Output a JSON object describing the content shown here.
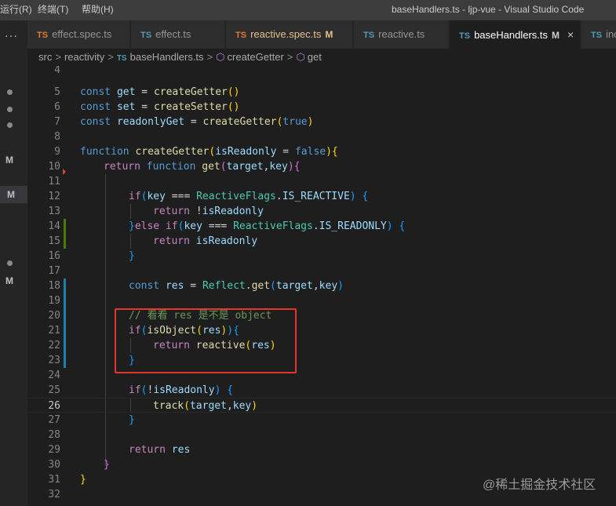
{
  "titlebar": {
    "menu_run": "运行(R)",
    "menu_terminal": "终端(T)",
    "menu_help": "帮助(H)",
    "window_title": "baseHandlers.ts - ljp-vue - Visual Studio Code"
  },
  "activity": {
    "more": "···",
    "badge_m": "M"
  },
  "tabs": [
    {
      "badge": "TS",
      "label": "effect.spec.ts",
      "mod": "",
      "active": false
    },
    {
      "badge": "TS",
      "label": "effect.ts",
      "mod": "",
      "active": false
    },
    {
      "badge": "TS",
      "label": "reactive.spec.ts",
      "mod": "M",
      "active": false
    },
    {
      "badge": "TS",
      "label": "reactive.ts",
      "mod": "",
      "active": false
    },
    {
      "badge": "TS",
      "label": "baseHandlers.ts",
      "mod": "M",
      "active": true,
      "close": "×"
    },
    {
      "badge": "TS",
      "label": "inc",
      "mod": "",
      "active": false
    }
  ],
  "breadcrumb": {
    "src": "src",
    "reactivity": "reactivity",
    "ts_badge": "TS",
    "file": "baseHandlers.ts",
    "symbol1": "createGetter",
    "symbol2": "get",
    "sep": ">"
  },
  "editor": {
    "line_numbers": [
      "4",
      "5",
      "6",
      "7",
      "8",
      "9",
      "10",
      "11",
      "12",
      "13",
      "14",
      "15",
      "16",
      "17",
      "18",
      "19",
      "20",
      "21",
      "22",
      "23",
      "24",
      "25",
      "26",
      "27",
      "28",
      "29",
      "30",
      "31",
      "32"
    ],
    "code": {
      "l5a": "const ",
      "l5b": "get",
      "l5c": " = ",
      "l5d": "createGetter",
      "l5e": "()",
      "l6a": "const ",
      "l6b": "set",
      "l6c": " = ",
      "l6d": "createSetter",
      "l6e": "()",
      "l7a": "const ",
      "l7b": "readonlyGet",
      "l7c": " = ",
      "l7d": "createGetter",
      "l7e": "(",
      "l7f": "true",
      "l7g": ")",
      "l9a": "function ",
      "l9b": "createGetter",
      "l9c": "(",
      "l9d": "isReadonly",
      "l9e": " = ",
      "l9f": "false",
      "l9g": "){",
      "l10a": "return ",
      "l10b": "function ",
      "l10c": "get",
      "l10d": "(",
      "l10e": "target",
      "l10f": ",",
      "l10g": "key",
      "l10h": "){",
      "l12a": "if",
      "l12b": "(",
      "l12c": "key",
      "l12d": " === ",
      "l12e": "ReactiveFlags",
      "l12f": ".",
      "l12g": "IS_REACTIVE",
      "l12h": ") {",
      "l13a": "return ",
      "l13b": "!",
      "l13c": "isReadonly",
      "l14a": "}",
      "l14b": "else ",
      "l14c": "if",
      "l14d": "(",
      "l14e": "key",
      "l14f": " === ",
      "l14g": "ReactiveFlags",
      "l14h": ".",
      "l14i": "IS_READONLY",
      "l14j": ") {",
      "l15a": "return ",
      "l15b": "isReadonly",
      "l16a": "}",
      "l18a": "const ",
      "l18b": "res",
      "l18c": " = ",
      "l18d": "Reflect",
      "l18e": ".",
      "l18f": "get",
      "l18g": "(",
      "l18h": "target",
      "l18i": ",",
      "l18j": "key",
      "l18k": ")",
      "l20a": "// 看看 res 是不是 object",
      "l21a": "if",
      "l21b": "(",
      "l21c": "isObject",
      "l21d": "(",
      "l21e": "res",
      "l21f": ")",
      "l21g": "){",
      "l22a": "return ",
      "l22b": "reactive",
      "l22c": "(",
      "l22d": "res",
      "l22e": ")",
      "l23a": "}",
      "l25a": "if",
      "l25b": "(",
      "l25c": "!",
      "l25d": "isReadonly",
      "l25e": ") {",
      "l26a": "track",
      "l26b": "(",
      "l26c": "target",
      "l26d": ",",
      "l26e": "key",
      "l26f": ")",
      "l27a": "}",
      "l29a": "return ",
      "l29b": "res",
      "l30a": "}",
      "l31a": "}"
    }
  },
  "watermark": "@稀土掘金技术社区",
  "colors": {
    "background": "#1e1e1e",
    "highlight_box": "#e5352f",
    "keyword": "#569cd6",
    "control": "#c586c0",
    "function": "#dcdcaa",
    "variable": "#9cdcfe",
    "type": "#4ec9b0",
    "comment": "#6a9955"
  }
}
